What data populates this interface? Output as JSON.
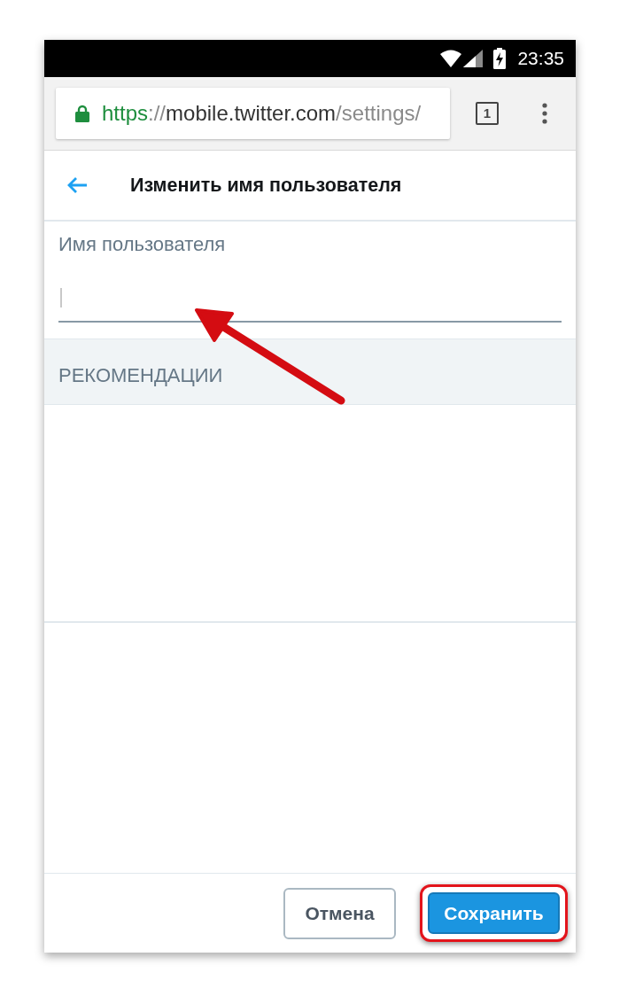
{
  "status_bar": {
    "time": "23:35"
  },
  "browser": {
    "secure": true,
    "url": {
      "scheme": "https",
      "separator": "://",
      "host": "mobile.twitter.com",
      "path": "/settings/"
    },
    "tab_count": "1"
  },
  "header": {
    "title": "Изменить имя пользователя"
  },
  "username_field": {
    "label": "Имя пользователя",
    "focused": true
  },
  "suggestions": {
    "heading": "РЕКОМЕНДАЦИИ"
  },
  "buttons": [
    {
      "kind": "secondary",
      "label": "Отмена",
      "highlighted": false
    },
    {
      "kind": "primary",
      "label": "Сохранить",
      "highlighted": true
    }
  ],
  "annotation": {
    "arrow": true
  }
}
